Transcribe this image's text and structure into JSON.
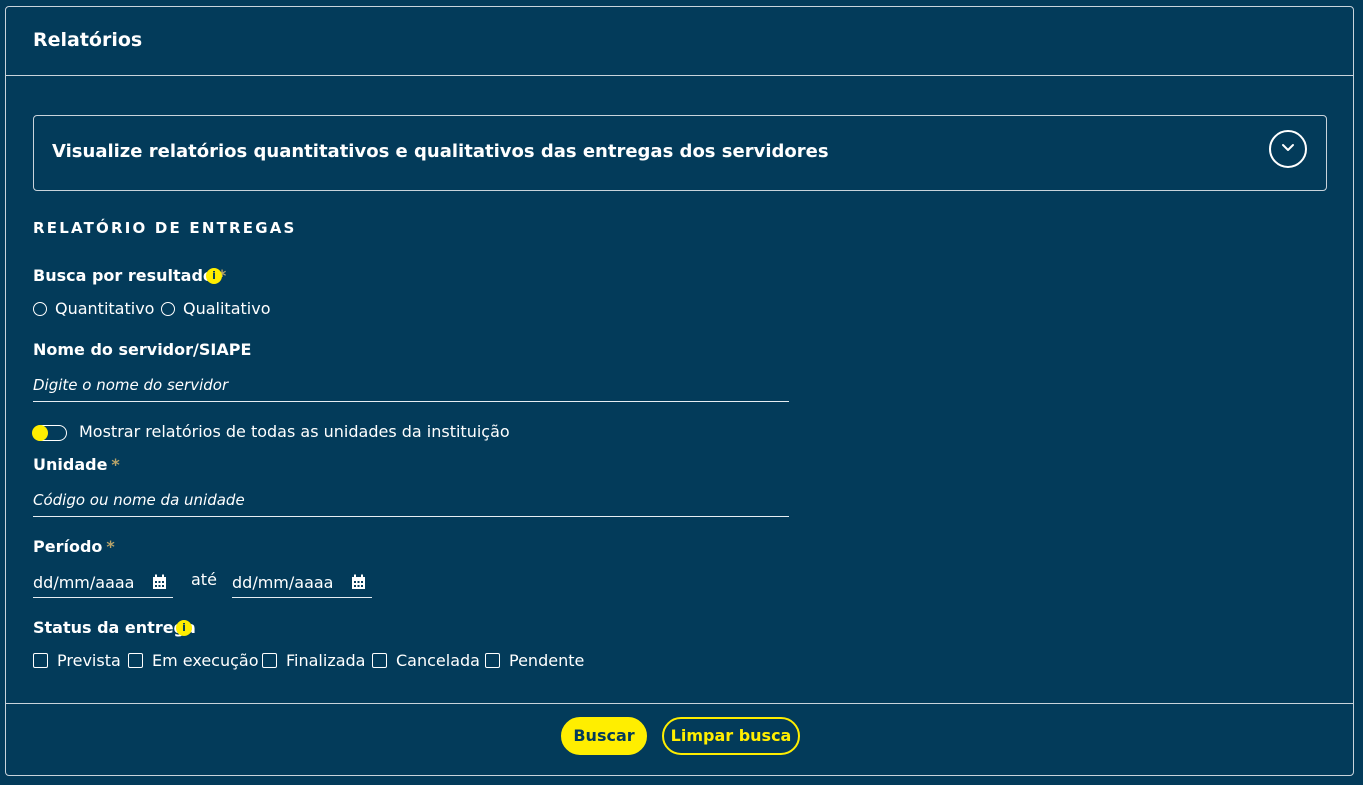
{
  "header": {
    "title": "Relatórios"
  },
  "accordion": {
    "text": "Visualize relatórios quantitativos e qualitativos das entregas dos servidores",
    "icon": "chevron-down-icon"
  },
  "section": {
    "title": "RELATÓRIO DE ENTREGAS"
  },
  "busca": {
    "label": "Busca por resultado",
    "required_mark": "*",
    "options": [
      "Quantitativo",
      "Qualitativo"
    ]
  },
  "servidor": {
    "label": "Nome do servidor/SIAPE",
    "placeholder": "Digite o nome do servidor"
  },
  "toggle": {
    "label": "Mostrar relatórios de todas as unidades da instituição",
    "state": "off"
  },
  "unidade": {
    "label": "Unidade",
    "required_mark": "*",
    "placeholder": "Código ou nome da unidade"
  },
  "periodo": {
    "label": "Período",
    "required_mark": "*",
    "start_placeholder": "dd/mm/aaaa",
    "separator": "até",
    "end_placeholder": "dd/mm/aaaa"
  },
  "status": {
    "label": "Status da entrega",
    "options": [
      "Prevista",
      "Em execução",
      "Finalizada",
      "Cancelada",
      "Pendente"
    ]
  },
  "buttons": {
    "search": "Buscar",
    "clear": "Limpar busca"
  },
  "colors": {
    "background": "#033b5a",
    "accent": "#ffee00",
    "required": "#b7a36a"
  }
}
